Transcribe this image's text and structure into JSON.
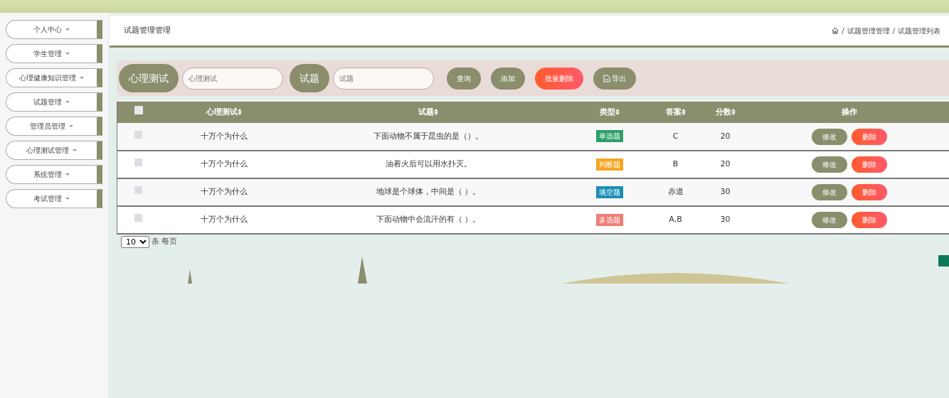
{
  "sidebar": {
    "items": [
      {
        "label": "个人中心"
      },
      {
        "label": "学生管理"
      },
      {
        "label": "心理健康知识管理"
      },
      {
        "label": "试题管理"
      },
      {
        "label": "管理员管理"
      },
      {
        "label": "心理测试管理"
      },
      {
        "label": "系统管理"
      },
      {
        "label": "考试管理"
      }
    ]
  },
  "header": {
    "title": "试题管理管理",
    "breadcrumb": [
      {
        "separator": "/",
        "label": "试题管理管理"
      },
      {
        "separator": "/",
        "label": "试题管理列表"
      }
    ]
  },
  "search": {
    "fields": [
      {
        "label": "心理测试",
        "placeholder": "心理测试"
      },
      {
        "label": "试题",
        "placeholder": "试题"
      }
    ],
    "buttons": [
      {
        "label": "查询",
        "kind": "normal"
      },
      {
        "label": "添加",
        "kind": "normal"
      },
      {
        "label": "批量删除",
        "kind": "danger"
      },
      {
        "label": "导出",
        "kind": "export"
      }
    ]
  },
  "table": {
    "columns": [
      {
        "label": "心理测试",
        "sortable": true
      },
      {
        "label": "试题",
        "sortable": true
      },
      {
        "label": "类型",
        "sortable": true
      },
      {
        "label": "答案",
        "sortable": true
      },
      {
        "label": "分数",
        "sortable": true
      },
      {
        "label": "操作",
        "sortable": false
      }
    ],
    "header_checked": false,
    "rows": [
      {
        "checked": false,
        "test": "十万个为什么",
        "question": "下面动物不属于昆虫的是（）。",
        "type": {
          "label": "单选题",
          "color": "#2e9e6b"
        },
        "answer": "C",
        "score": "20",
        "actions": [
          "修改",
          "删除"
        ]
      },
      {
        "checked": false,
        "test": "十万个为什么",
        "question": "油着火后可以用水扑灭。",
        "type": {
          "label": "判断题",
          "color": "#f5a623"
        },
        "answer": "B",
        "score": "20",
        "actions": [
          "修改",
          "删除"
        ]
      },
      {
        "checked": false,
        "test": "十万个为什么",
        "question": "地球是个球体，中间是（ ）。",
        "type": {
          "label": "填空题",
          "color": "#1a8fb5"
        },
        "answer": "赤道",
        "score": "30",
        "actions": [
          "修改",
          "删除"
        ]
      },
      {
        "checked": false,
        "test": "十万个为什么",
        "question": "下面动物中会流汗的有（ ）。",
        "type": {
          "label": "多选题",
          "color": "#ef7d75"
        },
        "answer": "A,B",
        "score": "30",
        "actions": [
          "修改",
          "删除"
        ]
      }
    ]
  },
  "pagination": {
    "page_size": "10",
    "suffix": "条 每页"
  }
}
